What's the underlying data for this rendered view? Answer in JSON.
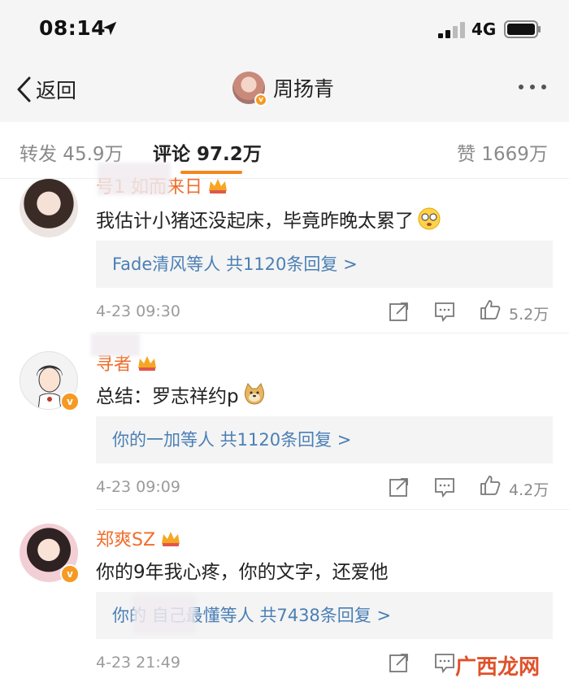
{
  "status_bar": {
    "time": "08:14",
    "network": "4G"
  },
  "nav": {
    "back_label": "返回",
    "title": "周扬青"
  },
  "tabs": {
    "repost": "转发 45.9万",
    "comment": "评论 97.2万",
    "like": "赞 1669万"
  },
  "comments": [
    {
      "name": "号1 如而来日",
      "text": "我估计小猪还没起床，毕竟昨晚太累了",
      "replies": "Fade清风等人  共1120条回复 >",
      "time": "4-23 09:30",
      "likes": "5.2万"
    },
    {
      "name": "寻者",
      "text": "总结：罗志祥约p",
      "replies": "你的一加等人  共1120条回复 >",
      "time": "4-23 09:09",
      "likes": "4.2万"
    },
    {
      "name": "郑爽SZ",
      "text": "你的9年我心疼，你的文字，还爱他",
      "replies": "你的 自己最懂等人  共7438条回复 >",
      "time": "4-23 21:49",
      "likes": ""
    }
  ],
  "watermark": "广西龙网",
  "colors": {
    "accent": "#f5861f",
    "name": "#f06d2b",
    "link": "#4a7fb5",
    "verified": "#f59a23"
  },
  "icons": [
    "location-arrow-icon",
    "signal-icon",
    "battery-icon",
    "back-chevron-icon",
    "more-icon",
    "crown-icon",
    "share-icon",
    "comment-icon",
    "like-icon"
  ]
}
